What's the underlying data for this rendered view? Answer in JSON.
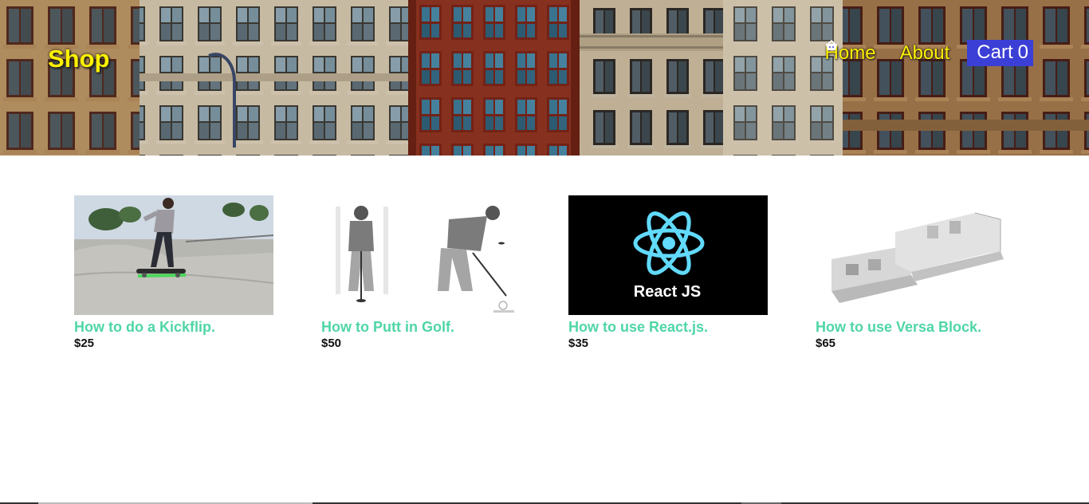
{
  "header": {
    "brand": "Shop",
    "nav": {
      "home": "Home",
      "about": "About",
      "cart_label": "Cart",
      "cart_count": "0"
    },
    "icons": {
      "cart": "basket-icon"
    }
  },
  "products": [
    {
      "title": "How to do a Kickflip.",
      "price": "$25",
      "image": "skateboarder-photo"
    },
    {
      "title": "How to Putt in Golf.",
      "price": "$50",
      "image": "golf-putting-illustration"
    },
    {
      "title": "How to use React.js.",
      "price": "$35",
      "image": "react-logo"
    },
    {
      "title": "How to use Versa Block.",
      "price": "$65",
      "image": "versa-block-photo"
    }
  ],
  "react_logo_caption": "React JS",
  "colors": {
    "brand_text": "#fff100",
    "product_title": "#4fd6a5",
    "cart_bg": "#3b3fd6",
    "price": "#111111"
  }
}
